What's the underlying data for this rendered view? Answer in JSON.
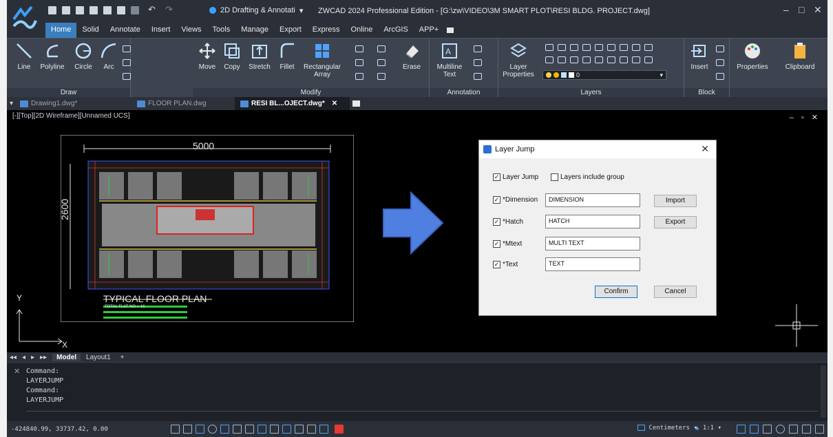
{
  "app": {
    "title": "ZWCAD 2024 Professional Edition - [G:\\zw\\VIDEO\\3M SMART PLOT\\RESI BLDG. PROJECT.dwg]",
    "workspace": "2D Drafting & Annotati",
    "accent": "#3a7fbe"
  },
  "ribbon_tabs": [
    "Home",
    "Solid",
    "Annotate",
    "Insert",
    "Views",
    "Tools",
    "Manage",
    "Export",
    "Express",
    "Online",
    "ArcGIS",
    "APP+"
  ],
  "ribbon": {
    "draw": {
      "label": "Draw",
      "line": "Line",
      "polyline": "Polyline",
      "circle": "Circle",
      "arc": "Arc"
    },
    "modify": {
      "label": "Modify",
      "move": "Move",
      "copy": "Copy",
      "stretch": "Stretch",
      "fillet": "Fillet",
      "rect_array": "Rectangular",
      "rect_array2": "Array",
      "erase": "Erase"
    },
    "annotation": {
      "label": "Annotation",
      "mtext": "Multiline",
      "mtext2": "Text"
    },
    "layers": {
      "label": "Layers",
      "props": "Layer",
      "props2": "Properties",
      "current": "0"
    },
    "block": {
      "label": "Block",
      "insert": "Insert"
    },
    "properties": "Properties",
    "clipboard": "Clipboard"
  },
  "doc_tabs": [
    "Drawing1.dwg*",
    "FLOOR PLAN.dwg",
    "RESI BL...OJECT.dwg*"
  ],
  "viewport": {
    "label": "[-][Top][2D Wireframe][Unnamed UCS]",
    "dim_top": "5000",
    "dim_left": "2600",
    "plan_title": "TYPICAL FLOOR PLAN",
    "plan_sub": "TOTAL FLAT NO = 16",
    "axis_x": "X",
    "axis_y": "Y"
  },
  "dialog": {
    "title": "Layer Jump",
    "layer_jump": "Layer Jump",
    "include_group": "Layers include group",
    "rows": [
      {
        "label": "*Dimension",
        "value": "DIMENSION"
      },
      {
        "label": "*Hatch",
        "value": "HATCH"
      },
      {
        "label": "*Mtext",
        "value": "MULTI TEXT"
      },
      {
        "label": "*Text",
        "value": "TEXT"
      }
    ],
    "import": "Import",
    "export": "Export",
    "confirm": "Confirm",
    "cancel": "Cancel"
  },
  "layout_tabs": [
    "Model",
    "Layout1",
    "+"
  ],
  "command_history": [
    "Command:",
    "LAYERJUMP",
    "Command:",
    "LAYERJUMP"
  ],
  "status": {
    "coords": "-424840.99, 33737.42, 0.00",
    "units": "Centimeters",
    "scale": "1:1"
  }
}
